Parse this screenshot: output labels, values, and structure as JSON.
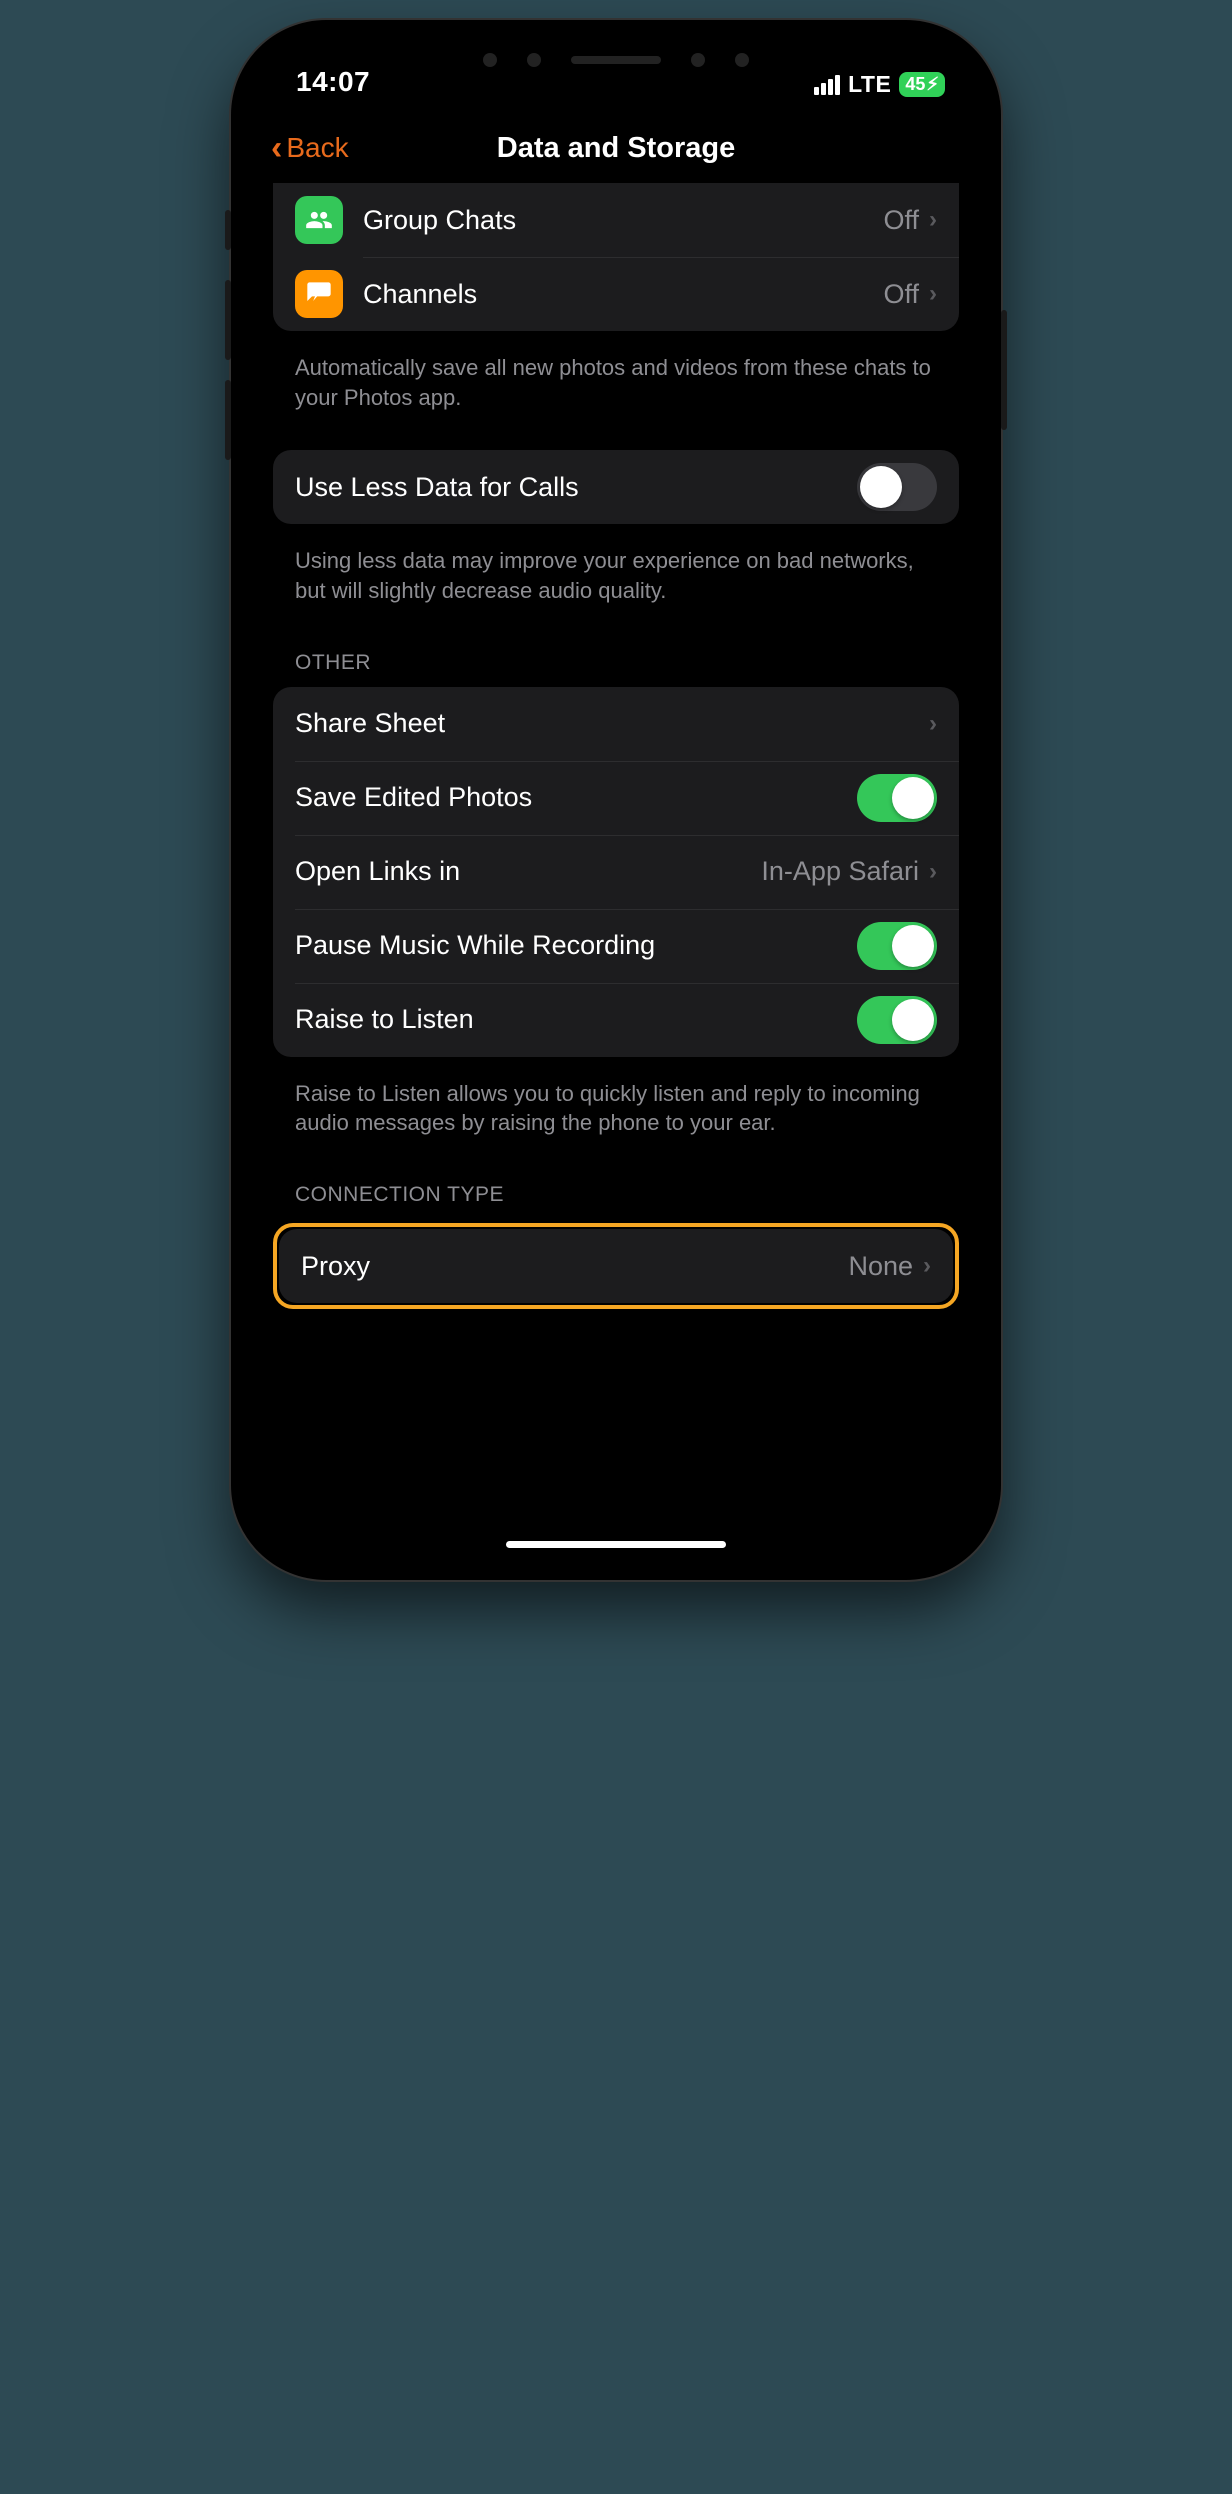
{
  "status": {
    "time": "14:07",
    "network": "LTE",
    "battery": "45"
  },
  "nav": {
    "back": "Back",
    "title": "Data and Storage"
  },
  "autosave": {
    "groupChats": {
      "label": "Group Chats",
      "value": "Off"
    },
    "channels": {
      "label": "Channels",
      "value": "Off"
    },
    "footer": "Automatically save all new photos and videos from these chats to your Photos app."
  },
  "lessData": {
    "label": "Use Less Data for Calls",
    "on": false,
    "footer": "Using less data may improve your experience on bad networks, but will slightly decrease audio quality."
  },
  "other": {
    "header": "OTHER",
    "shareSheet": {
      "label": "Share Sheet"
    },
    "saveEdited": {
      "label": "Save Edited Photos",
      "on": true
    },
    "openLinks": {
      "label": "Open Links in",
      "value": "In-App Safari"
    },
    "pauseMusic": {
      "label": "Pause Music While Recording",
      "on": true
    },
    "raise": {
      "label": "Raise to Listen",
      "on": true
    },
    "footer": "Raise to Listen allows you to quickly listen and reply to incoming audio messages by raising the phone to your ear."
  },
  "connection": {
    "header": "CONNECTION TYPE",
    "proxy": {
      "label": "Proxy",
      "value": "None"
    }
  }
}
